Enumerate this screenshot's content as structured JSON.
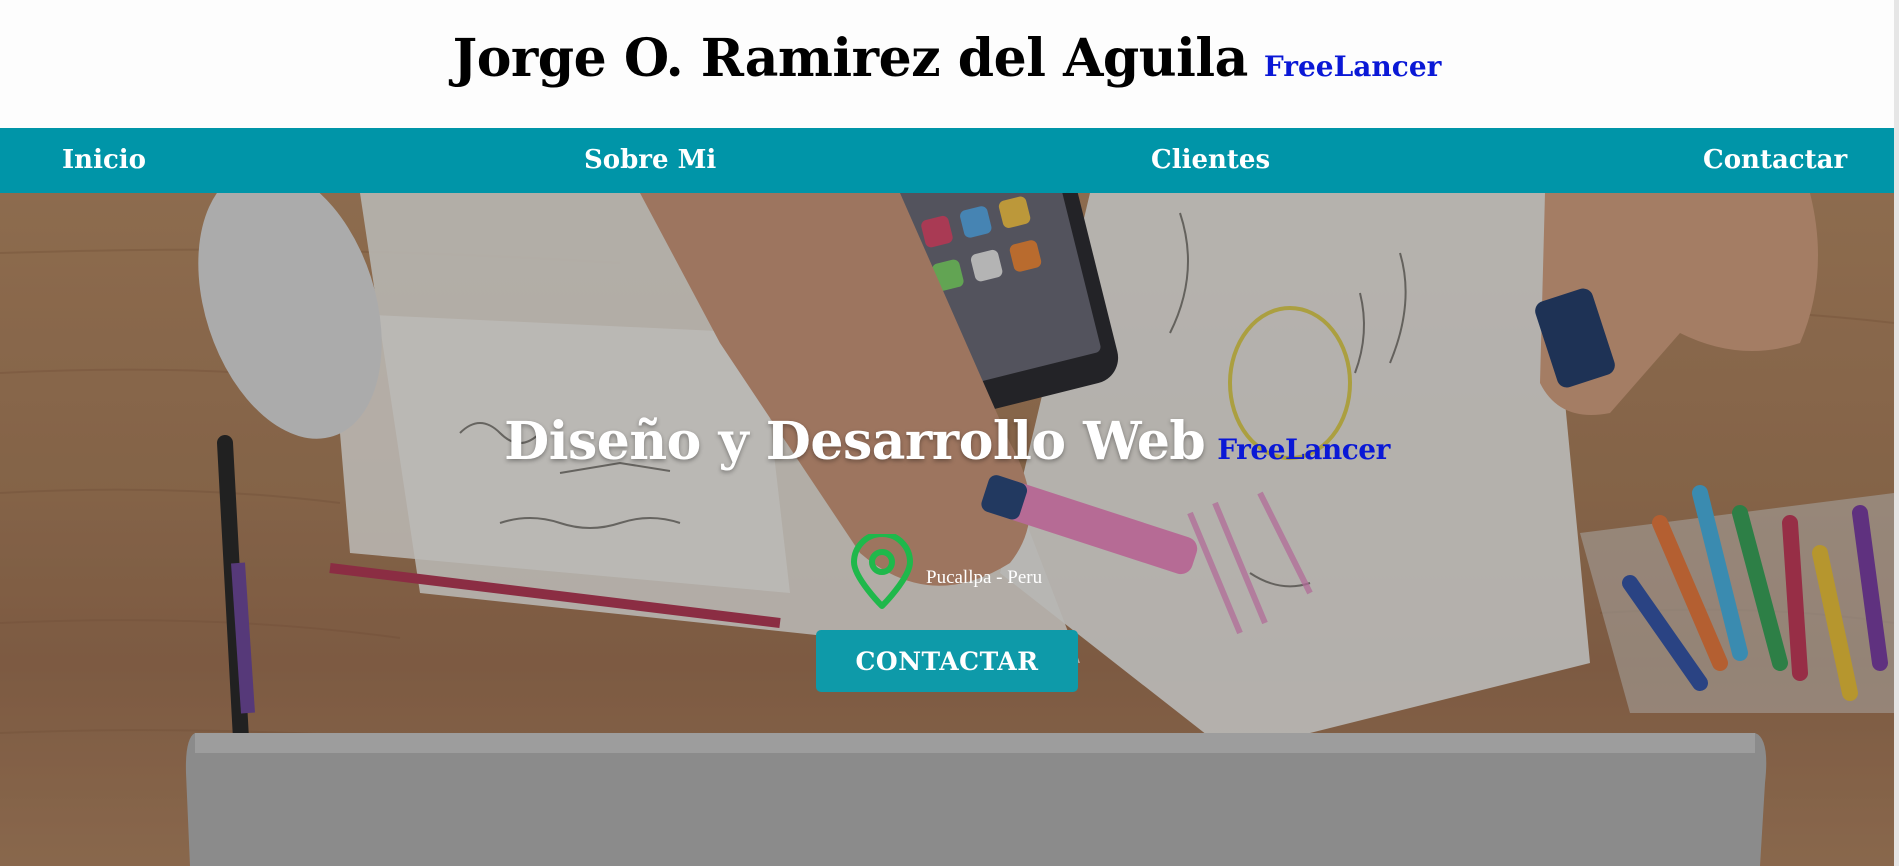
{
  "header": {
    "title": "Jorge O. Ramirez del Aguila",
    "tag": "FreeLancer"
  },
  "nav": {
    "items": [
      {
        "label": "Inicio"
      },
      {
        "label": "Sobre Mi"
      },
      {
        "label": "Clientes"
      },
      {
        "label": "Contactar"
      }
    ]
  },
  "hero": {
    "title": "Diseño y Desarrollo Web",
    "tag": "FreeLancer",
    "location_icon": "map-pin-icon",
    "location": "Pucallpa - Peru",
    "cta_label": "CONTACTAR"
  },
  "colors": {
    "nav_bg": "#0095a8",
    "cta_bg": "#0e9aa9",
    "tag_blue": "#0a18d6",
    "pin_green": "#1fb84b"
  }
}
